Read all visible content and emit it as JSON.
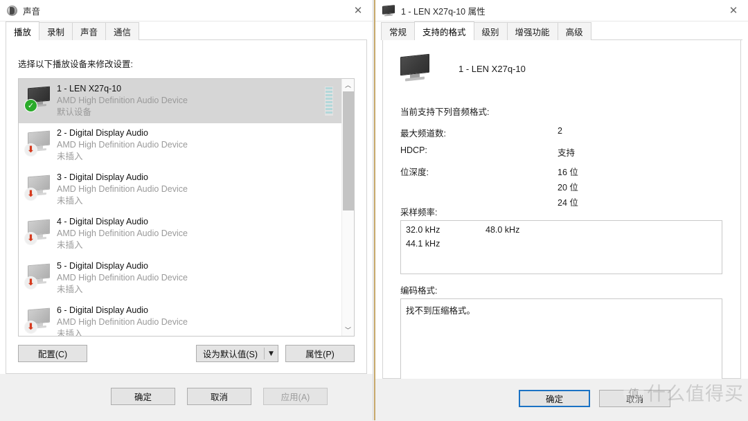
{
  "sound_window": {
    "title": "声音",
    "icon": "speaker-icon",
    "close_label": "✕",
    "tabs": [
      {
        "label": "播放",
        "active": true
      },
      {
        "label": "录制",
        "active": false
      },
      {
        "label": "声音",
        "active": false
      },
      {
        "label": "通信",
        "active": false
      }
    ],
    "prompt": "选择以下播放设备来修改设置:",
    "devices": [
      {
        "name": "1 - LEN X27q-10",
        "driver": "AMD High Definition Audio Device",
        "status": "默认设备",
        "state": "default",
        "selected": true,
        "meter": true
      },
      {
        "name": "2 - Digital Display Audio",
        "driver": "AMD High Definition Audio Device",
        "status": "未插入",
        "state": "unplugged",
        "selected": false,
        "meter": false
      },
      {
        "name": "3 - Digital Display Audio",
        "driver": "AMD High Definition Audio Device",
        "status": "未插入",
        "state": "unplugged",
        "selected": false,
        "meter": false
      },
      {
        "name": "4 - Digital Display Audio",
        "driver": "AMD High Definition Audio Device",
        "status": "未插入",
        "state": "unplugged",
        "selected": false,
        "meter": false
      },
      {
        "name": "5 - Digital Display Audio",
        "driver": "AMD High Definition Audio Device",
        "status": "未插入",
        "state": "unplugged",
        "selected": false,
        "meter": false
      },
      {
        "name": "6 - Digital Display Audio",
        "driver": "AMD High Definition Audio Device",
        "status": "未插入",
        "state": "unplugged",
        "selected": false,
        "meter": false
      }
    ],
    "buttons": {
      "configure": "配置(C)",
      "set_default": "设为默认值(S)",
      "set_default_arrow": "▼",
      "properties": "属性(P)"
    },
    "footer": {
      "ok": "确定",
      "cancel": "取消",
      "apply": "应用(A)"
    },
    "scroll": {
      "up_arrow": "︿",
      "down_arrow": "﹀"
    }
  },
  "props_window": {
    "title": "1 - LEN X27q-10 属性",
    "icon": "monitor-icon",
    "close_label": "✕",
    "tabs": [
      {
        "label": "常规",
        "active": false
      },
      {
        "label": "支持的格式",
        "active": true
      },
      {
        "label": "级别",
        "active": false
      },
      {
        "label": "增强功能",
        "active": false
      },
      {
        "label": "高级",
        "active": false
      }
    ],
    "device_name": "1 - LEN X27q-10",
    "section_heading": "当前支持下列音频格式:",
    "specs": [
      {
        "label": "最大频道数:",
        "value": "2"
      },
      {
        "label": "HDCP:",
        "value": "支持"
      },
      {
        "label": "位深度:",
        "value": "16 位"
      }
    ],
    "bit_depth_extra": [
      "20 位",
      "24 位"
    ],
    "sample_rate_label": "采样频率:",
    "sample_rates": [
      "32.0 kHz",
      "48.0 kHz",
      "44.1 kHz"
    ],
    "encoding_label": "编码格式:",
    "encoding_value": "找不到压缩格式。",
    "footer": {
      "ok": "确定",
      "cancel": "取消"
    }
  },
  "watermark": {
    "logo": "值",
    "text": "什么值得买"
  },
  "colors": {
    "accent_blue": "#1a72c4",
    "default_green": "#2aab2a",
    "unplugged_red": "#d63a1e",
    "selection_gray": "#d6d6d6",
    "active_window_border": "#c6a86a",
    "meter_teal": "#b3d8da"
  }
}
